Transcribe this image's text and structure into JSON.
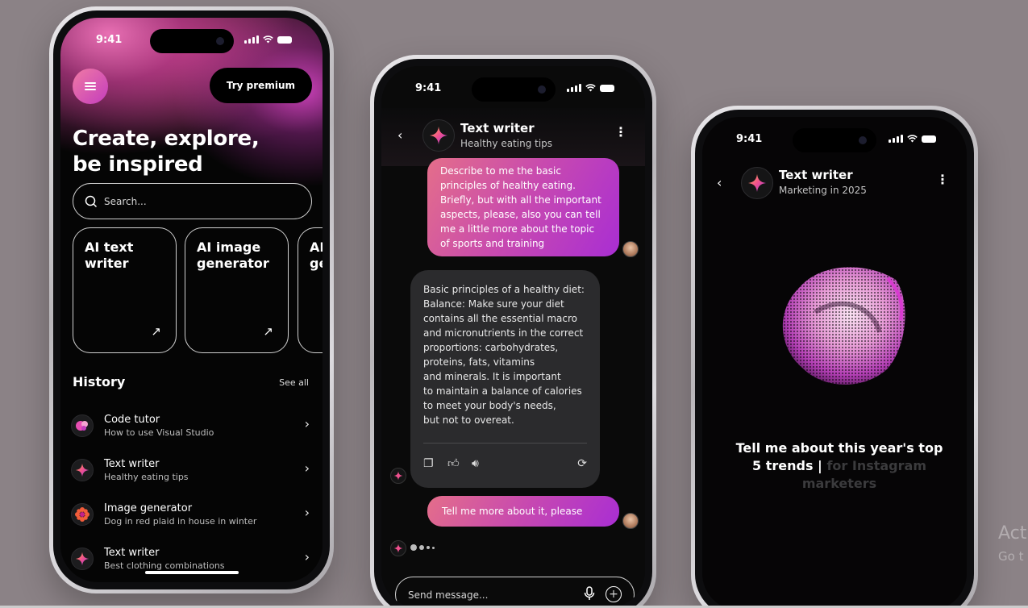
{
  "phone1": {
    "status_time": "9:41",
    "premium_label": "Try premium",
    "headline_line1": "Create, explore,",
    "headline_line2": "be inspired",
    "search_placeholder": "Search...",
    "cards": [
      {
        "line1": "AI text",
        "line2": "writer"
      },
      {
        "line1": "AI image",
        "line2": "generator"
      },
      {
        "line1": "AI",
        "line2": "ge"
      }
    ],
    "history_title": "History",
    "see_all": "See all",
    "history": [
      {
        "title": "Code tutor",
        "subtitle": "How to use Visual Studio",
        "icon": "code-tutor-icon"
      },
      {
        "title": "Text writer",
        "subtitle": "Healthy eating tips",
        "icon": "sparkle-icon"
      },
      {
        "title": "Image generator",
        "subtitle": "Dog in red plaid in house in winter",
        "icon": "flower-icon"
      },
      {
        "title": "Text writer",
        "subtitle": "Best clothing combinations",
        "icon": "sparkle-icon"
      }
    ]
  },
  "phone2": {
    "status_time": "9:41",
    "title": "Text writer",
    "subtitle": "Healthy eating tips",
    "user_message": [
      "Describe to me the basic",
      "principles of healthy eating.",
      "Briefly, but with all the important",
      "aspects, please, also you can tell",
      "me a little more about the topic",
      "of sports and training"
    ],
    "ai_message": [
      "Basic principles of a healthy diet:",
      "Balance: Make sure your diet",
      "contains all the essential macro",
      "and micronutrients in the correct",
      "proportions: carbohydrates,",
      "proteins, fats, vitamins",
      "and minerals. It is important",
      "to maintain a balance of calories",
      "to meet your body's needs,",
      "but not to overeat."
    ],
    "followup_message": "Tell me more about it, please",
    "send_placeholder": "Send message..."
  },
  "phone3": {
    "status_time": "9:41",
    "title": "Text writer",
    "subtitle": "Marketing in 2025",
    "prompt_typed_line1": "Tell me about this year's top",
    "prompt_typed_line2": "5 trends |",
    "prompt_faded_line2": "for Instagram",
    "prompt_faded_line3": "marketers"
  },
  "watermark": {
    "line1": "Act",
    "line2": "Go t"
  },
  "colors": {
    "background": "#8b8286",
    "accent_pink": "#e46e8a",
    "accent_purple": "#a92ed3"
  }
}
